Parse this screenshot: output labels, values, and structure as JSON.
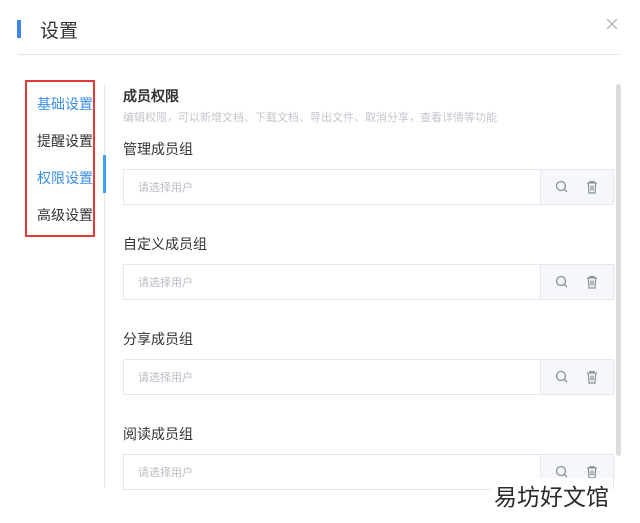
{
  "dialog": {
    "title": "设置",
    "close_icon": "close-icon"
  },
  "sidebar": {
    "items": [
      {
        "label": "基础设置",
        "active": true
      },
      {
        "label": "提醒设置",
        "active": false
      },
      {
        "label": "权限设置",
        "active": true
      },
      {
        "label": "高级设置",
        "active": false
      }
    ]
  },
  "content": {
    "section_title": "成员权限",
    "section_desc": "编辑权限，可以新增文档、下载文档、导出文件、取消分享，查看详情等功能",
    "groups": [
      {
        "label": "管理成员组",
        "placeholder": "请选择用户"
      },
      {
        "label": "自定义成员组",
        "placeholder": "请选择用户"
      },
      {
        "label": "分享成员组",
        "placeholder": "请选择用户"
      },
      {
        "label": "阅读成员组",
        "placeholder": "请选择用户"
      }
    ],
    "icons": {
      "search": "search-icon",
      "delete": "trash-icon"
    }
  },
  "watermark": "易坊好文馆",
  "colors": {
    "accent": "#3c86e8",
    "active_text": "#3a8ee6",
    "highlight_border": "#e23b3b"
  }
}
